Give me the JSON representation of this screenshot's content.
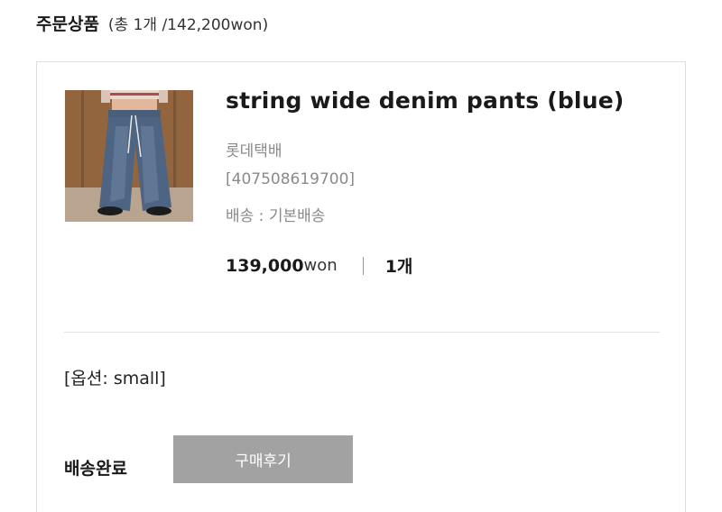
{
  "header": {
    "title": "주문상품",
    "summary": "(총 1개 /142,200won)"
  },
  "product": {
    "name": "string wide denim pants (blue)",
    "courier": "롯데택배",
    "tracking": "[407508619700]",
    "delivery": "배송 : 기본배송",
    "price_amount": "139,000",
    "price_unit": "won",
    "quantity": "1개",
    "image_icon": "denim-pants-photo"
  },
  "option": {
    "text": "[옵션: small]"
  },
  "status": {
    "label": "배송완료",
    "review_button": "구매후기"
  },
  "colors": {
    "button_bg": "#a2a2a2",
    "border": "#dedede",
    "muted_text": "#8a8a8a"
  }
}
